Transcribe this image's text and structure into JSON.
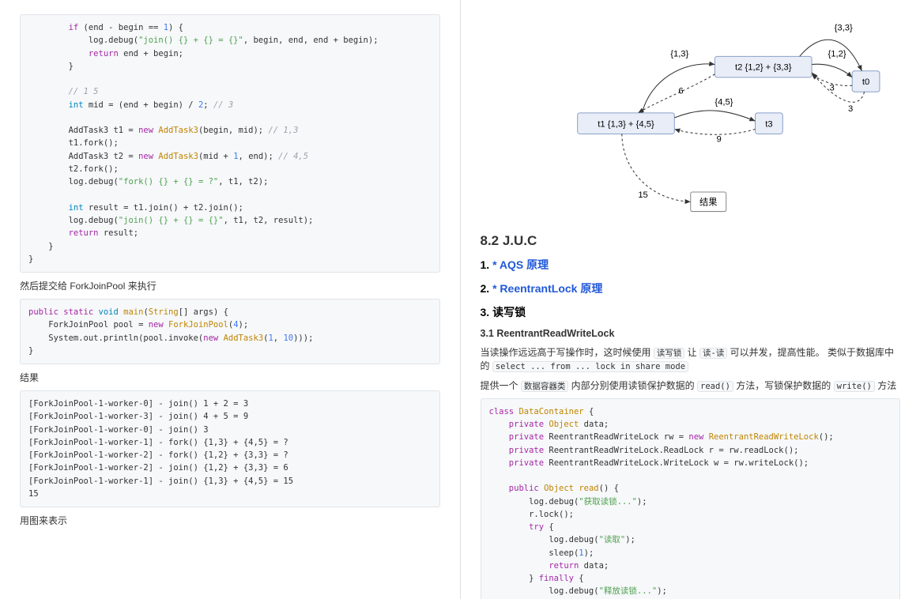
{
  "left": {
    "code1_html": "        <span class='k'>if</span> (end - begin == <span class='n'>1</span>) {\n            log.debug(<span class='s'>\"join() {} + {} = {}\"</span>, begin, end, end + begin);\n            <span class='k'>return</span> end + begin;\n        }\n\n        <span class='c'>// 1 5</span>\n        <span class='kblue'>int</span> mid = (end + begin) / <span class='n'>2</span>; <span class='c'>// 3</span>\n\n        AddTask3 t1 = <span class='k'>new</span> <span class='t'>AddTask3</span>(begin, mid); <span class='c'>// 1,3</span>\n        t1.fork();\n        AddTask3 t2 = <span class='k'>new</span> <span class='t'>AddTask3</span>(mid + <span class='n'>1</span>, end); <span class='c'>// 4,5</span>\n        t2.fork();\n        log.debug(<span class='s'>\"fork() {} + {} = ?\"</span>, t1, t2);\n\n        <span class='kblue'>int</span> result = t1.join() + t2.join();\n        log.debug(<span class='s'>\"join() {} + {} = {}\"</span>, t1, t2, result);\n        <span class='k'>return</span> result;\n    }\n}",
    "p1": "然后提交给 ForkJoinPool 来执行",
    "code2_html": "<span class='k'>public static</span> <span class='kblue'>void</span> <span class='t'>main</span>(<span class='t'>String</span>[] args) {\n    ForkJoinPool pool = <span class='k'>new</span> <span class='t'>ForkJoinPool</span>(<span class='n'>4</span>);\n    System.out.println(pool.invoke(<span class='k'>new</span> <span class='t'>AddTask3</span>(<span class='n'>1</span>, <span class='n'>10</span>)));\n}",
    "p2": "结果",
    "code3": "[ForkJoinPool-1-worker-0] - join() 1 + 2 = 3\n[ForkJoinPool-1-worker-3] - join() 4 + 5 = 9\n[ForkJoinPool-1-worker-0] - join() 3\n[ForkJoinPool-1-worker-1] - fork() {1,3} + {4,5} = ?\n[ForkJoinPool-1-worker-2] - fork() {1,2} + {3,3} = ?\n[ForkJoinPool-1-worker-2] - join() {1,2} + {3,3} = 6\n[ForkJoinPool-1-worker-1] - join() {1,3} + {4,5} = 15\n15",
    "p3": "用图来表示"
  },
  "right": {
    "diagram": {
      "t1": "t1 {1,3} + {4,5}",
      "t2": "t2 {1,2} + {3,3}",
      "t3": "t3",
      "t0": "t0",
      "res": "结果",
      "e13": "{1,3}",
      "e12": "{1,2}",
      "e33": "{3,3}",
      "e45": "{4,5}",
      "v6": "6",
      "v3a": "3",
      "v3b": "3",
      "v9": "9",
      "v15": "15"
    },
    "h2": "8.2 J.U.C",
    "h3a_prefix": "1. ",
    "h3a_link": "* AQS 原理",
    "h3b_prefix": "2. ",
    "h3b_link": "* ReentrantLock 原理",
    "h3c": "3. 读写锁",
    "h4a": "3.1 ReentrantReadWriteLock",
    "p1_a": "当读操作远远高于写操作时，这时候使用 ",
    "p1_code1": "读写锁",
    "p1_b": " 让 ",
    "p1_code2": "读-读",
    "p1_c": " 可以并发，提高性能。 类似于数据库中的 ",
    "p1_code3": "select ... from ... lock in share mode",
    "p2_a": "提供一个 ",
    "p2_code1": "数据容器类",
    "p2_b": " 内部分别使用读锁保护数据的 ",
    "p2_code2": "read()",
    "p2_c": " 方法，写锁保护数据的 ",
    "p2_code3": "write()",
    "p2_d": " 方法",
    "code1_html": "<span class='k'>class</span> <span class='t'>DataContainer</span> {\n    <span class='k'>private</span> <span class='t'>Object</span> data;\n    <span class='k'>private</span> ReentrantReadWriteLock rw = <span class='k'>new</span> <span class='t'>ReentrantReadWriteLock</span>();\n    <span class='k'>private</span> ReentrantReadWriteLock.ReadLock r = rw.readLock();\n    <span class='k'>private</span> ReentrantReadWriteLock.WriteLock w = rw.writeLock();\n\n    <span class='k'>public</span> <span class='t'>Object</span> <span class='t'>read</span>() {\n        log.debug(<span class='s'>\"获取读锁...\"</span>);\n        r.lock();\n        <span class='k'>try</span> {\n            log.debug(<span class='s'>\"读取\"</span>);\n            sleep(<span class='n'>1</span>);\n            <span class='k'>return</span> data;\n        } <span class='k'>finally</span> {\n            log.debug(<span class='s'>\"释放读锁...\"</span>);"
  }
}
